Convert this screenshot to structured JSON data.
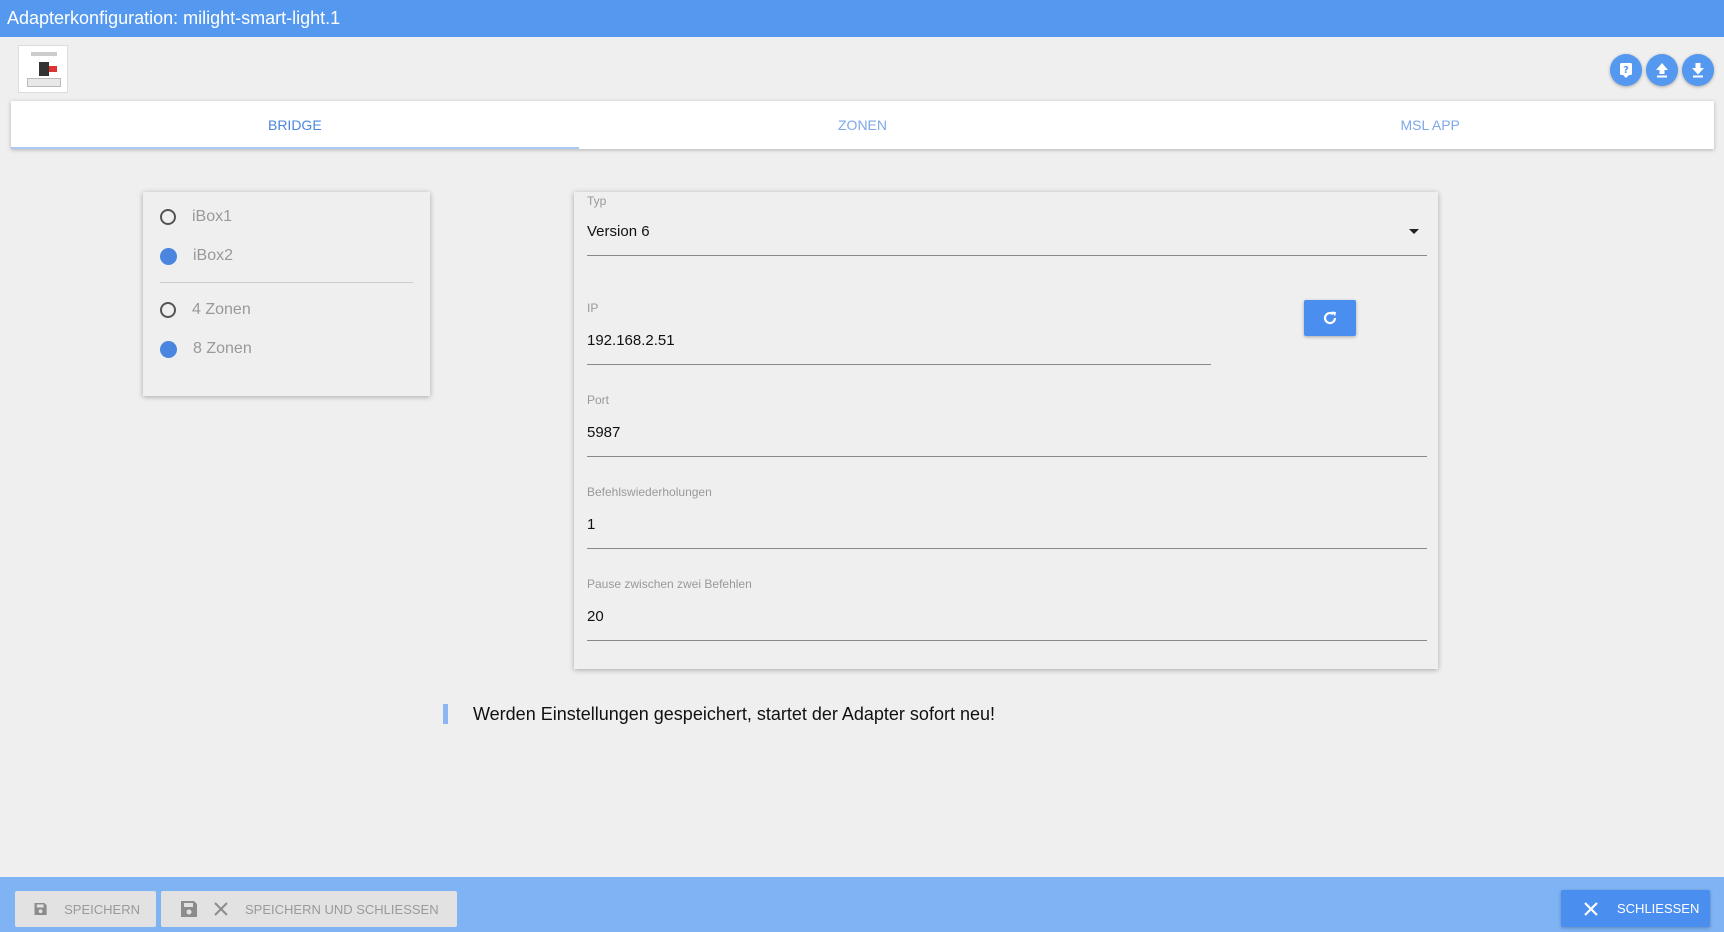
{
  "window": {
    "title": "Adapterkonfiguration: milight-smart-light.1"
  },
  "header_icons": [
    "help-icon",
    "upload-icon",
    "download-icon"
  ],
  "tabs": [
    {
      "label": "BRIDGE",
      "active": true
    },
    {
      "label": "ZONEN",
      "active": false
    },
    {
      "label": "MSL APP",
      "active": false
    }
  ],
  "bridge_options": {
    "box_type": [
      {
        "label": "iBox1",
        "checked": false
      },
      {
        "label": "iBox2",
        "checked": true
      }
    ],
    "zone_count": [
      {
        "label": "4 Zonen",
        "checked": false
      },
      {
        "label": "8 Zonen",
        "checked": true
      }
    ]
  },
  "form": {
    "typ": {
      "label": "Typ",
      "value": "Version 6"
    },
    "ip": {
      "label": "IP",
      "value": "192.168.2.51"
    },
    "port": {
      "label": "Port",
      "value": "5987"
    },
    "repeats": {
      "label": "Befehlswiederholungen",
      "value": "1"
    },
    "pause": {
      "label": "Pause zwischen zwei Befehlen",
      "value": "20"
    }
  },
  "notice": "Werden Einstellungen gespeichert, startet der Adapter sofort neu!",
  "footer": {
    "save_label": "SPEICHERN",
    "save_close_label": "SPEICHERN UND SCHLIESSEN",
    "close_label": "SCHLIESSEN"
  },
  "colors": {
    "accent": "#4a86e0",
    "titlebar": "#5498ef",
    "footer": "#7fb3f4"
  }
}
